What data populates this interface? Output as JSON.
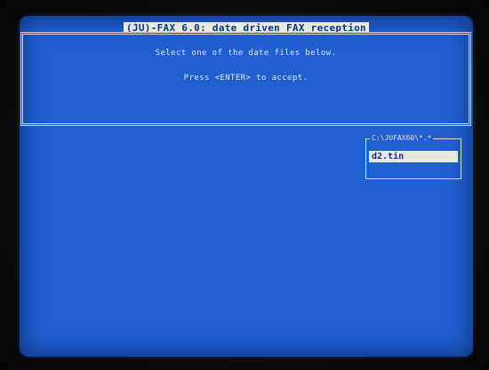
{
  "app": {
    "title": "(JU)-FAX 6.0: date driven FAX reception"
  },
  "dialog": {
    "line1": "Select one of the date files below.",
    "line2": "Press <ENTER> to accept."
  },
  "file_picker": {
    "path": "C:\\JUFAX60\\*.*",
    "items": [
      {
        "label": "d2.tin",
        "selected": true
      }
    ]
  },
  "colors": {
    "screen_background": "#1f5fd0",
    "highlight_background": "#e9e9e2",
    "highlight_text": "#0e2f8a",
    "text": "#e6e6de"
  }
}
